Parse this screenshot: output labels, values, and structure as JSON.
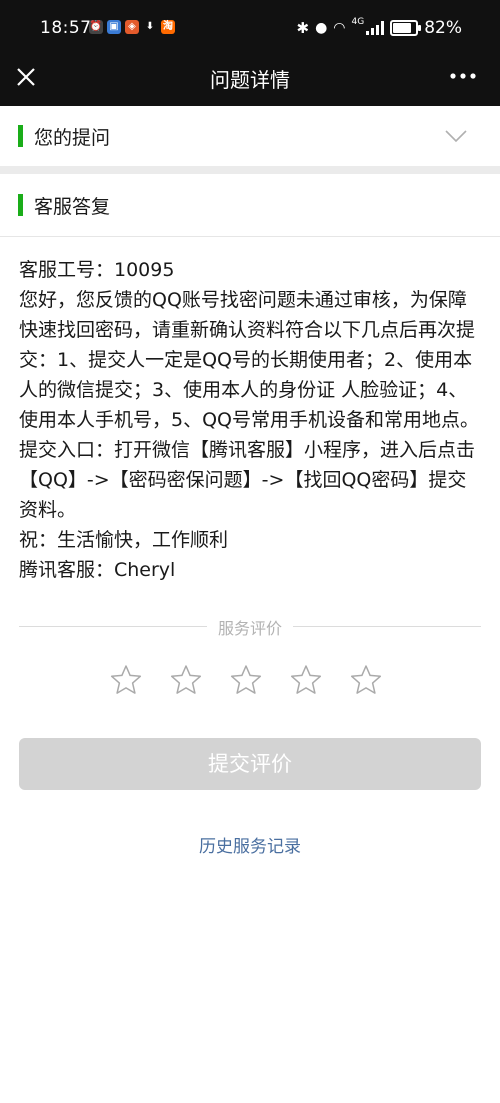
{
  "status_bar": {
    "time": "18:57",
    "battery_text": "82%",
    "battery_level": 0.82,
    "network_label": "4G"
  },
  "nav": {
    "title": "问题详情"
  },
  "sections": {
    "question_title": "您的提问",
    "reply_title": "客服答复"
  },
  "reply": {
    "text": "客服工号：10095\n您好，您反馈的QQ账号找密问题未通过审核，为保障快速找回密码，请重新确认资料符合以下几点后再次提交：1、提交人一定是QQ号的长期使用者；2、使用本人的微信提交；3、使用本人的身份证 人脸验证；4、使用本人手机号，5、QQ号常用手机设备和常用地点。提交入口：打开微信【腾讯客服】小程序，进入后点击【QQ】->【密码密保问题】->【找回QQ密码】提交资料。\n祝：生活愉快，工作顺利\n腾讯客服：Cheryl"
  },
  "rating": {
    "label": "服务评价",
    "stars_total": 5,
    "stars_selected": 0
  },
  "submit_label": "提交评价",
  "history_label": "历史服务记录",
  "colors": {
    "accent_green": "#1aad19",
    "link_blue": "#4a6fa0",
    "disabled_button": "#d3d3d3"
  }
}
